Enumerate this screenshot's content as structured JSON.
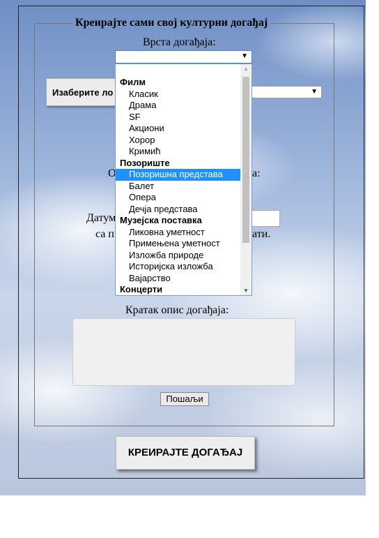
{
  "form": {
    "legend": "Креирајте сами свој културни догађај",
    "event_type_label": "Врста догађаја:",
    "event_type_value": "",
    "location_button_label": "Изаберите ло",
    "text_left_1": "О",
    "text_right_1": "а:",
    "date_label_left": "Датум",
    "date_value": "",
    "text_left_2": "са п",
    "text_right_2": "ати.",
    "description_label": "Кратак опис догађаја:",
    "description_value": "",
    "send_label": "Пошаљи"
  },
  "dropdown": {
    "groups": [
      {
        "label": "Филм",
        "options": [
          "Класик",
          "Драма",
          "SF",
          "Акциони",
          "Хорор",
          "Кримић"
        ]
      },
      {
        "label": "Позориште",
        "options": [
          "Позоришна представа",
          "Балет",
          "Опера",
          "Дечја представа"
        ]
      },
      {
        "label": "Музејска поставка",
        "options": [
          "Ликовна уметност",
          "Примењена уметност",
          "Изложба природе",
          "Историјска изложба",
          "Вајарство"
        ]
      },
      {
        "label": "Концерти",
        "options": []
      }
    ],
    "highlighted": "Позоришна представа"
  },
  "create_button_label": "КРЕИРАЈТЕ ДОГАЂАЈ",
  "icons": {
    "dropdown_arrow": "▼",
    "scroll_up": "▲",
    "scroll_down": "▼"
  },
  "colors": {
    "highlight": "#1e90ff"
  }
}
